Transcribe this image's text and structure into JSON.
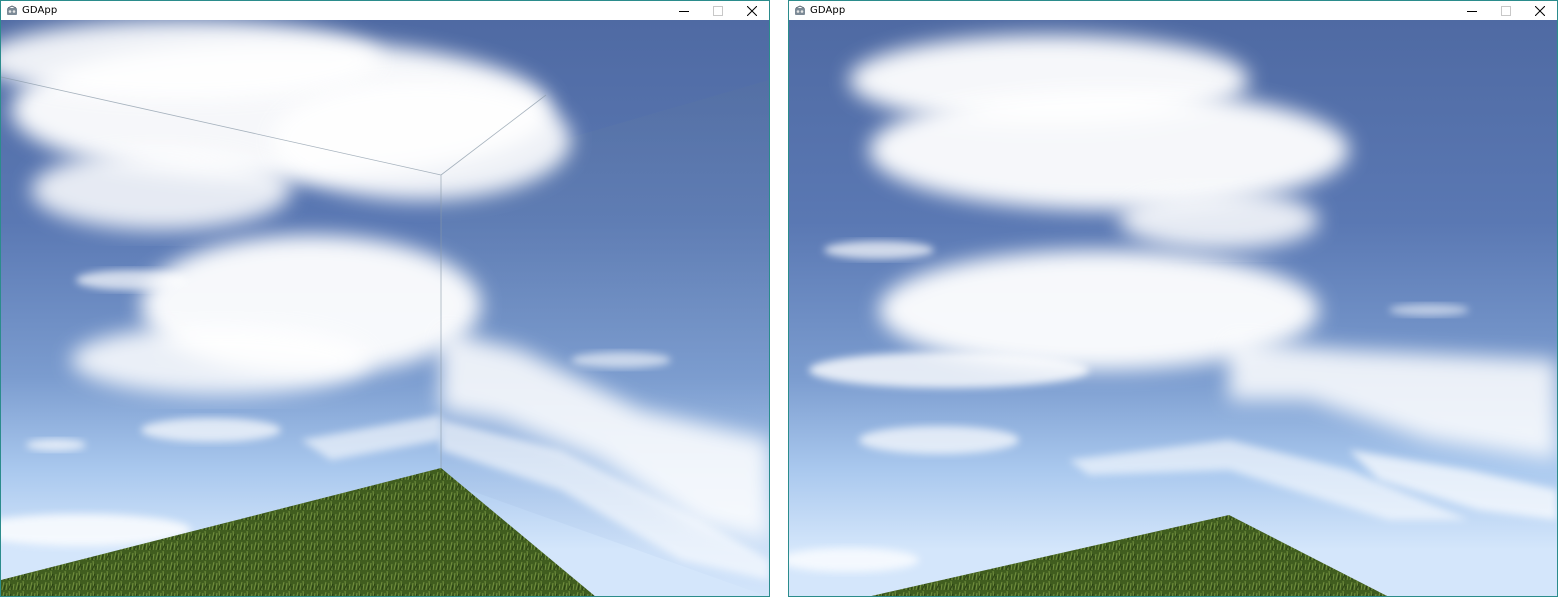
{
  "windows": [
    {
      "title": "GDApp",
      "app_icon": "gd-app-icon",
      "controls": {
        "minimize": "minimize-icon",
        "maximize": "maximize-icon",
        "close": "close-icon"
      },
      "scene": {
        "sky": "skybox-clouds",
        "ground": "grass-plane",
        "seam_lines_visible": true
      }
    },
    {
      "title": "GDApp",
      "app_icon": "gd-app-icon",
      "controls": {
        "minimize": "minimize-icon",
        "maximize": "maximize-icon",
        "close": "close-icon"
      },
      "scene": {
        "sky": "skybox-clouds",
        "ground": "grass-plane",
        "seam_lines_visible": false
      }
    }
  ],
  "colors": {
    "window_border": "#2b8c8c",
    "sky_top": "#4f6aa3",
    "sky_horizon": "#d4e6fb",
    "grass_dark": "#2f4a1a",
    "grass_light": "#7fa043"
  }
}
